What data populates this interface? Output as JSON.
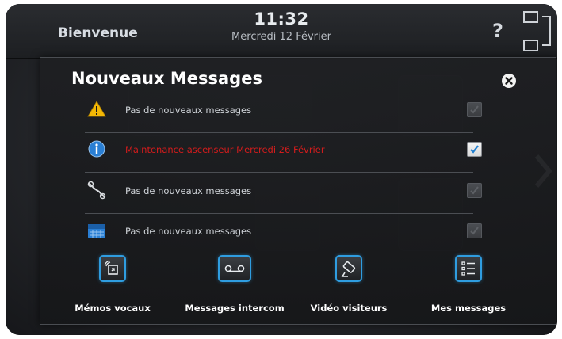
{
  "header": {
    "welcome": "Bienvenue",
    "time": "11:32",
    "date": "Mercredi 12 Février",
    "help": "?"
  },
  "dialog": {
    "title": "Nouveaux Messages",
    "messages": [
      {
        "icon": "warning-icon",
        "text": "Pas de nouveaux messages",
        "checked": false,
        "alert": false
      },
      {
        "icon": "info-icon",
        "text": "Maintenance ascenseur Mercredi 26 Février",
        "checked": true,
        "alert": true
      },
      {
        "icon": "wrench-icon",
        "text": "Pas de nouveaux messages",
        "checked": false,
        "alert": false
      },
      {
        "icon": "calendar-icon",
        "text": "Pas de nouveaux messages",
        "checked": false,
        "alert": false
      }
    ],
    "actions": [
      {
        "icon": "voice-memo-icon",
        "label": "Mémos vocaux"
      },
      {
        "icon": "intercom-tape-icon",
        "label": "Messages intercom"
      },
      {
        "icon": "camera-icon",
        "label": "Vidéo visiteurs"
      },
      {
        "icon": "list-icon",
        "label": "Mes messages"
      }
    ]
  },
  "colors": {
    "accent": "#2f9de0",
    "alert": "#d41c1c",
    "warning": "#f2b705",
    "info": "#2a7fd4"
  }
}
